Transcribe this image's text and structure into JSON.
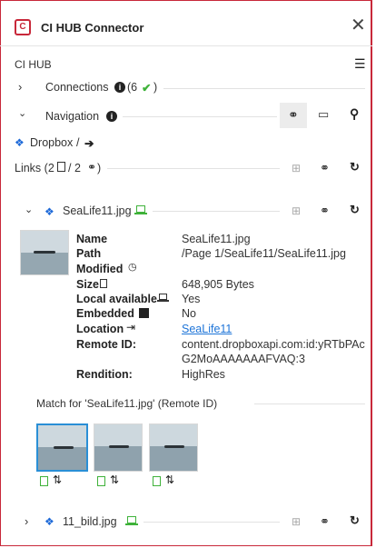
{
  "app": {
    "title": "CI HUB Connector",
    "close_glyph": "✕",
    "logo_glyph": "C"
  },
  "section": {
    "label": "CI HUB",
    "menu_glyph": "☰"
  },
  "connections": {
    "label": "Connections",
    "count": "(6",
    "check": "✔",
    "close_paren": ")"
  },
  "navigation": {
    "label": "Navigation"
  },
  "breadcrumb": {
    "source": "Dropbox",
    "sep": "/",
    "arrow": "➔"
  },
  "links": {
    "label": "Links (2",
    "sep": "/ 2",
    "close_paren": ")"
  },
  "items": [
    {
      "filename": "SeaLife11.jpg",
      "details": [
        {
          "label": "Name",
          "value": "SeaLife11.jpg"
        },
        {
          "label": "Path",
          "value": "/Page 1/SeaLife11/SeaLife11.jpg"
        },
        {
          "label": "Modified",
          "value": ""
        },
        {
          "label": "Size",
          "value": "648,905 Bytes"
        },
        {
          "label": "Local available",
          "value": "Yes"
        },
        {
          "label": "Embedded",
          "value": "No"
        },
        {
          "label": "Location",
          "value": "SeaLife11"
        },
        {
          "label": "Remote ID:",
          "value": "content.dropboxapi.com:id:yRTbPAc"
        },
        {
          "label": "",
          "value": "G2MoAAAAAAAFVAQ:3"
        },
        {
          "label": "Rendition:",
          "value": "HighRes"
        }
      ],
      "match_label": "Match for 'SeaLife11.jpg' (Remote ID)",
      "matches": [
        {
          "selected": true
        },
        {
          "selected": false
        },
        {
          "selected": false
        }
      ]
    },
    {
      "filename": "11_bild.jpg"
    }
  ],
  "colors": {
    "brand": "#c8283a",
    "dropbox": "#1d69d8",
    "check": "#3fb23a",
    "select": "#2a8fd6"
  }
}
